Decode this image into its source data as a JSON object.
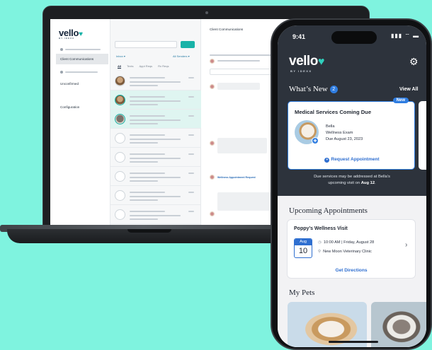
{
  "laptop": {
    "brand": "vello",
    "brand_sub": "BY IDEXX",
    "sidebar": {
      "items": [
        {
          "label": "Client Communications",
          "active": true
        },
        {
          "label": "Unconfirmed",
          "active": false
        },
        {
          "label": "Configuration",
          "active": false
        }
      ]
    },
    "list": {
      "filter_left": "Inbox ▾",
      "filter_right": "All Senders ▾",
      "tabs": [
        "All",
        "Texts",
        "Appt Reqs",
        "Rx Reqs"
      ]
    },
    "chat": {
      "title": "Client Communications",
      "link_text": "Wellness Appointment Request"
    }
  },
  "phone": {
    "status_time": "9:41",
    "status_icons": "▮▮▮ ⌔ ▬",
    "brand": "vello",
    "brand_sub": "BY IDEXX",
    "whats_new": {
      "title": "What’s New",
      "badge_count": "2",
      "view_all": "View All",
      "card": {
        "badge": "New",
        "title": "Medical Services Coming Due",
        "pet_name": "Bella",
        "service": "Wellness Exam",
        "due": "Due August 23, 2023",
        "action": "Request Appointment"
      },
      "note_line1": "Due services may be addressed at Bella’s",
      "note_line2_prefix": "upcoming visit on ",
      "note_line2_bold": "Aug 12",
      "note_line2_suffix": "."
    },
    "upcoming": {
      "title": "Upcoming Appointments",
      "card": {
        "title": "Poppy’s Wellness Visit",
        "cal_month": "Aug",
        "cal_day": "10",
        "time": "10:00 AM | Friday, August 28",
        "clinic": "New Moon Veterinary Clinic",
        "action": "Get Directions"
      }
    },
    "pets": {
      "title": "My Pets"
    }
  },
  "colors": {
    "background": "#7ff3df",
    "brand_teal": "#19b3a8",
    "accent_blue": "#2f7de1",
    "phone_header": "#2d333c"
  }
}
